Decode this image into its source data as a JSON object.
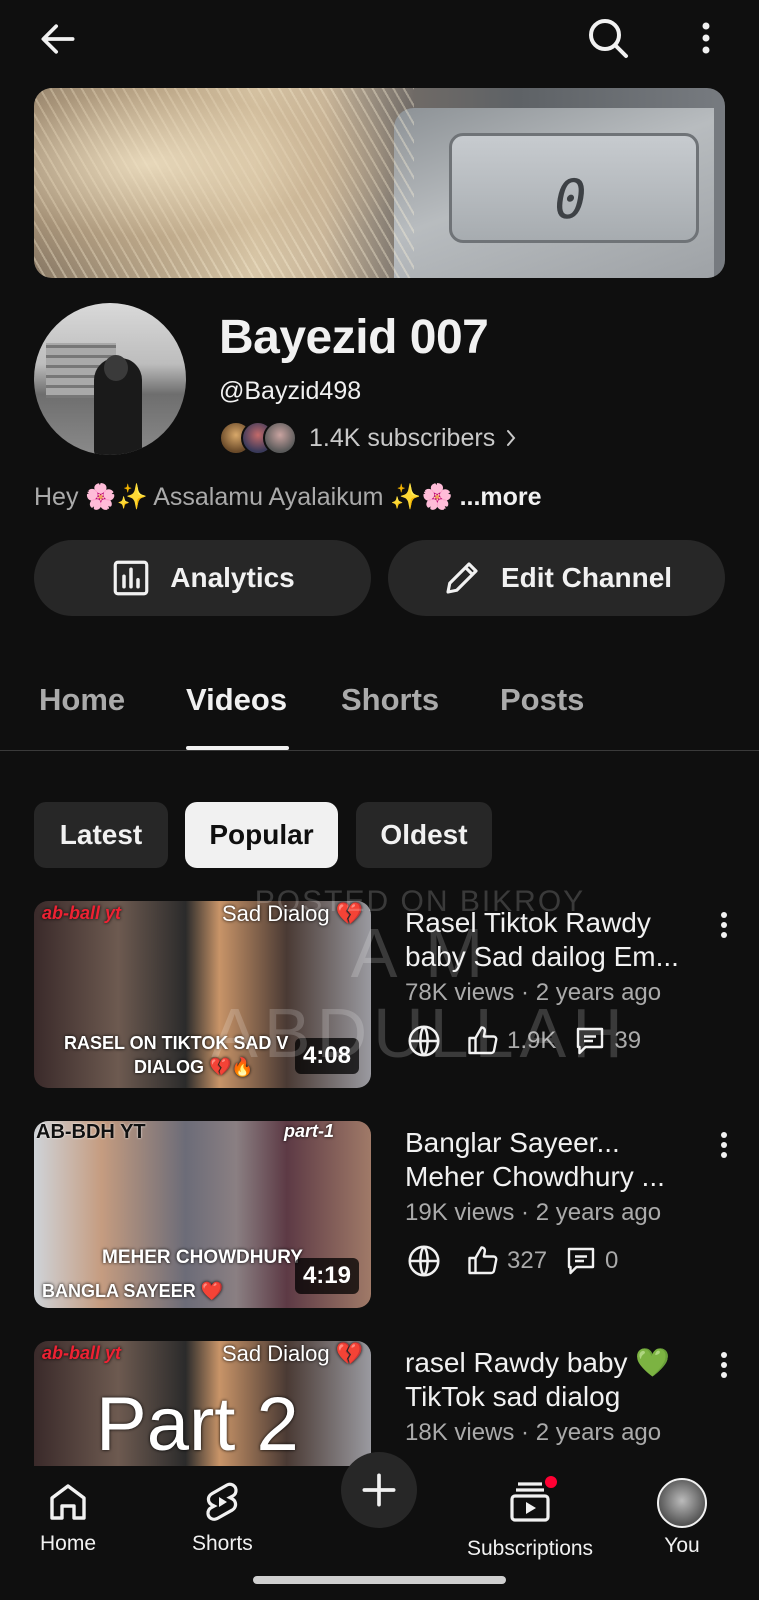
{
  "header": {
    "icons": {
      "back": "arrow-left-icon",
      "search": "search-icon",
      "more": "more-vert-icon"
    }
  },
  "channel": {
    "name": "Bayezid 007",
    "handle": "@Bayzid498",
    "subscribers": "1.4K subscribers",
    "description": "Hey 🌸✨ Assalamu Ayalaikum ✨🌸",
    "more_label": "...more"
  },
  "actions": {
    "analytics_label": "Analytics",
    "edit_label": "Edit Channel"
  },
  "tabs": [
    {
      "label": "Home",
      "active": false
    },
    {
      "label": "Videos",
      "active": true
    },
    {
      "label": "Shorts",
      "active": false
    },
    {
      "label": "Posts",
      "active": false
    }
  ],
  "filters": [
    {
      "label": "Latest",
      "selected": false
    },
    {
      "label": "Popular",
      "selected": true
    },
    {
      "label": "Oldest",
      "selected": false
    }
  ],
  "videos": [
    {
      "title_line1": "Rasel Tiktok Rawdy",
      "title_line2": "baby Sad dailog Em...",
      "meta": "78K views · 2 years ago",
      "likes": "1.9K",
      "comments": "39",
      "duration": "4:08",
      "thumb_text_top": "ab-ball yt",
      "thumb_text_badge": "Sad Dialog 💔",
      "thumb_text_bottom": "RASEL ON TIKTOK SAD V",
      "thumb_text_bottom2": "DIALOG 💔🔥"
    },
    {
      "title_line1": "Banglar Sayeer...",
      "title_line2": "Meher Chowdhury ...",
      "meta": "19K views · 2 years ago",
      "likes": "327",
      "comments": "0",
      "duration": "4:19",
      "thumb_text_top": "AB-BDH YT",
      "thumb_text_badge": "part-1",
      "thumb_text_bottom": "MEHER CHOWDHURY",
      "thumb_text_bottom2": "BANGLA SAYEER ❤️"
    },
    {
      "title_line1": "rasel Rawdy baby 💚",
      "title_line2": "TikTok sad dialog",
      "meta": "18K views · 2 years ago",
      "thumb_text_top": "ab-ball yt",
      "thumb_text_badge": "Sad Dialog 💔",
      "thumb_text_big": "Part 2"
    }
  ],
  "watermark": {
    "line1": "POSTED ON BIKROY",
    "line2": "A M ABDULLAH"
  },
  "bottom_nav": [
    {
      "label": "Home",
      "icon": "home-icon"
    },
    {
      "label": "Shorts",
      "icon": "shorts-icon"
    },
    {
      "label": "",
      "icon": "plus-icon"
    },
    {
      "label": "Subscriptions",
      "icon": "subscriptions-icon"
    },
    {
      "label": "You",
      "icon": "avatar"
    }
  ],
  "colors": {
    "background": "#0f0f0f",
    "surface": "#272727",
    "text": "#f1f1f1",
    "secondary": "#aaaaaa",
    "badge": "#ff0033"
  }
}
